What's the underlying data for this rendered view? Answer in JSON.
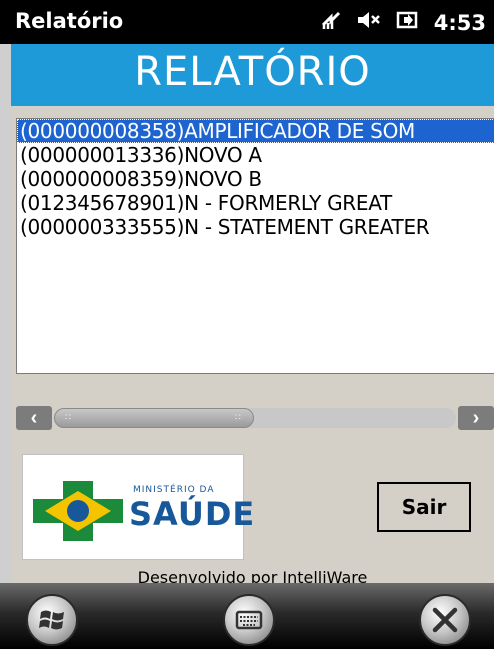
{
  "statusbar": {
    "title": "Relatório",
    "time": "4:53",
    "icons": [
      "signal-icon",
      "volume-muted-icon",
      "battery-charging-icon"
    ]
  },
  "header": {
    "title": "RELATÓRIO"
  },
  "list": {
    "items": [
      "(000000008358)AMPLIFICADOR DE SOM",
      "(000000013336)NOVO A",
      "(000000008359)NOVO B",
      "(012345678901)N - FORMERLY GREAT",
      "(000000333555)N - STATEMENT GREATER"
    ],
    "selected_index": 0
  },
  "logo": {
    "ministry_text": "MINISTÉRIO DA",
    "name_text": "SAÚDE"
  },
  "buttons": {
    "exit_label": "Sair"
  },
  "footer": {
    "credit": "Desenvolvido por IntelliWare"
  },
  "colors": {
    "header_blue": "#1e9ad8",
    "selection_blue": "#1e64d0",
    "form_gray": "#d4d0c8"
  }
}
